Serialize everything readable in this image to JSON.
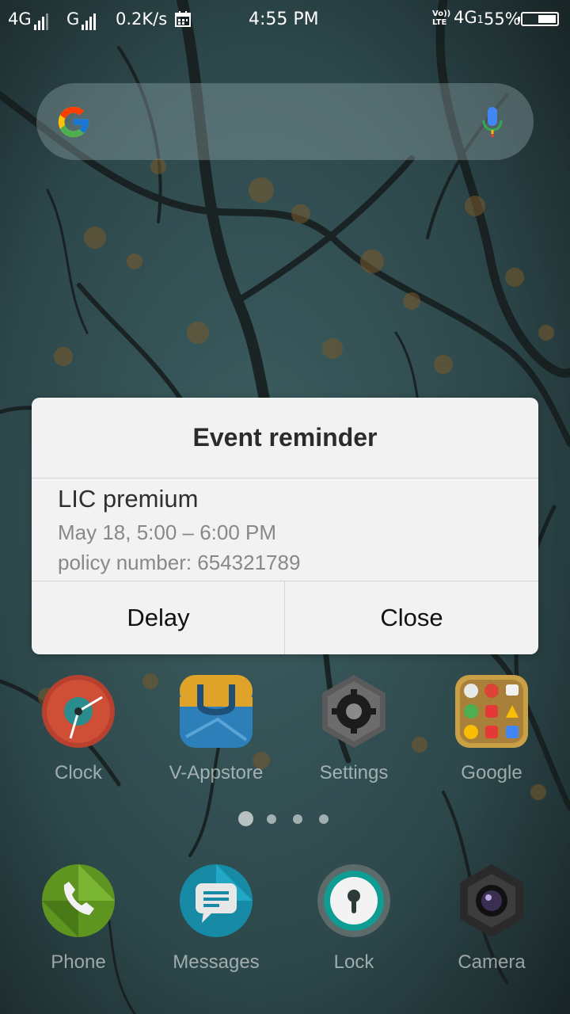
{
  "status_bar": {
    "network_1": "4G",
    "network_2": "G",
    "speed": "0.2K/s",
    "time": "4:55 PM",
    "volte_top": "Vo))",
    "volte_bottom": "LTE",
    "network_3": "4G",
    "network_3_sub": "1",
    "battery_percent": "55%",
    "battery_level": 0.55
  },
  "search": {
    "brand_icon": "google-g-icon",
    "mic_icon": "microphone-icon"
  },
  "dialog": {
    "title": "Event reminder",
    "event_title": "LIC premium",
    "event_time": "May 18, 5:00 – 6:00 PM",
    "event_note": "policy number: 654321789",
    "delay_label": "Delay",
    "close_label": "Close"
  },
  "apps_row_1": [
    {
      "label": "Clock",
      "icon": "clock-icon"
    },
    {
      "label": "V-Appstore",
      "icon": "appstore-bag-icon"
    },
    {
      "label": "Settings",
      "icon": "gear-icon"
    },
    {
      "label": "Google",
      "icon": "google-folder-icon"
    }
  ],
  "dock": [
    {
      "label": "Phone",
      "icon": "phone-icon"
    },
    {
      "label": "Messages",
      "icon": "message-bubble-icon"
    },
    {
      "label": "Lock",
      "icon": "keyhole-icon"
    },
    {
      "label": "Camera",
      "icon": "camera-lens-icon"
    }
  ],
  "pages": {
    "count": 4,
    "active": 0
  },
  "colors": {
    "dialog_bg": "#f2f2f2",
    "clock_red": "#c0392b",
    "appstore_blue": "#2c7fb8",
    "phone_green": "#6aa321",
    "messages_teal": "#1e9cb8",
    "lock_teal": "#0f9c93"
  }
}
